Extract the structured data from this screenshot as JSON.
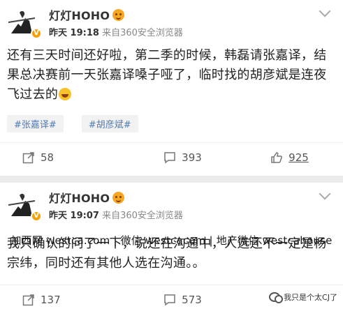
{
  "posts": [
    {
      "username": "灯灯HOHO",
      "time": "昨天 19:18",
      "source": "来自360安全浏览器",
      "content": "还有三天时间还好啦，第二季的时候，韩磊请张嘉译，结果总决赛前一天张嘉译嗓子哑了，临时找的胡彦斌是连夜飞过去的",
      "tags": [
        "#张嘉译#",
        "#胡彦斌#"
      ],
      "reposts": "58",
      "comments": "393",
      "likes": "925"
    },
    {
      "username": "灯灯HOHO",
      "time": "昨天 19:07",
      "source": "来自360安全浏览器",
      "content": "我只确认的问了一下，说还在沟通中，人选还不一定是杨宗纬，同时还有其他人选在沟通。。",
      "reposts": "137",
      "comments": "573"
    }
  ],
  "watermark": "加西网 westca.com | 微信 westcacom | 地产微信 westcahouse",
  "wechat_account": "我只是个太CJ了",
  "colors": {
    "tag_text": "#4f7bb5",
    "vip_badge": "#f6a623",
    "divider": "#eeeeee"
  },
  "icons": [
    "avatar-knight-icon",
    "vip-smiley-icon",
    "chevron-down-icon",
    "repost-icon",
    "comment-icon",
    "like-icon",
    "laugh-emoji-icon",
    "wechat-icon"
  ]
}
